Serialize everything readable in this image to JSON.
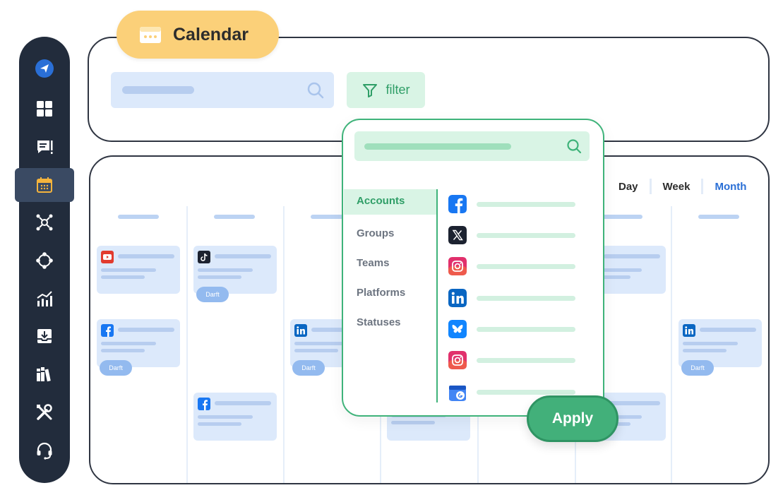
{
  "app": {
    "title": "Calendar",
    "colors": {
      "sidebar": "#222c3c",
      "accent_green": "#42b07a",
      "accent_blue": "#2a6fd6",
      "tab_yellow": "#fbd079"
    }
  },
  "sidebar": {
    "items": [
      {
        "icon": "send-icon"
      },
      {
        "icon": "dashboard-icon"
      },
      {
        "icon": "posts-icon"
      },
      {
        "icon": "calendar-icon",
        "active": true
      },
      {
        "icon": "network-icon"
      },
      {
        "icon": "connections-icon"
      },
      {
        "icon": "analytics-icon"
      },
      {
        "icon": "inbox-download-icon"
      },
      {
        "icon": "library-icon"
      },
      {
        "icon": "tools-icon"
      },
      {
        "icon": "support-headset-icon"
      }
    ]
  },
  "toolbar": {
    "filter_label": "filter"
  },
  "views": {
    "day": "Day",
    "week": "Week",
    "month": "Month",
    "active": "Month"
  },
  "cards": [
    {
      "icon": "youtube-icon"
    },
    {
      "icon": "tiktok-icon",
      "badge": "Darft"
    },
    {
      "icon": "facebook-icon",
      "badge": "Darft"
    },
    {
      "icon": "linkedin-icon",
      "badge": "Darft"
    },
    {
      "icon": "facebook-icon"
    },
    {
      "icon": "linkedin-icon",
      "badge": "Darft"
    }
  ],
  "filter_popup": {
    "categories": [
      "Accounts",
      "Groups",
      "Teams",
      "Platforms",
      "Statuses"
    ],
    "active_category": "Accounts",
    "accounts": [
      {
        "icon": "facebook-icon"
      },
      {
        "icon": "x-icon"
      },
      {
        "icon": "instagram-icon"
      },
      {
        "icon": "linkedin-icon"
      },
      {
        "icon": "bluesky-icon"
      },
      {
        "icon": "instagram-icon"
      },
      {
        "icon": "google-business-icon"
      }
    ],
    "apply_label": "Apply"
  }
}
